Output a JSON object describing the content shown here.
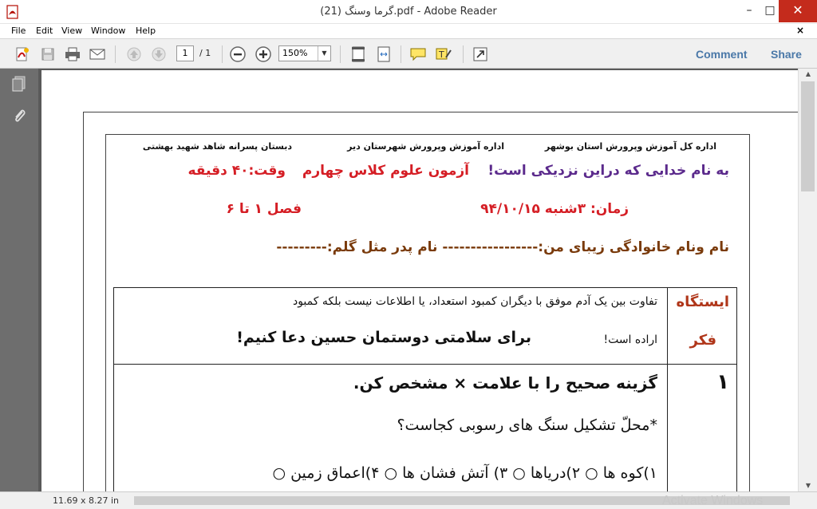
{
  "window": {
    "title": "گرما وسنگ (21).pdf - Adobe Reader",
    "minimize": "–",
    "maximize": "□",
    "close": "✕"
  },
  "menu": {
    "items": [
      "File",
      "Edit",
      "View",
      "Window",
      "Help"
    ],
    "close": "×"
  },
  "toolbar": {
    "page_current": "1",
    "page_total": "/ 1",
    "zoom": "150%",
    "comment_label": "Comment",
    "share_label": "Share"
  },
  "status": {
    "page_size": "11.69 x 8.27 in",
    "watermark": "Activate Windows"
  },
  "document": {
    "header_row1": {
      "right": "اداره کل آموزش وپرورش استان بوشهر",
      "middle": "اداره آموزش وپرورش شهرستان دیر",
      "left": "دبستان پسرانه شاهد شهید بهشتی"
    },
    "header_row2": {
      "right": "به نام خدایی که دراین نزدیکی است!",
      "middle": "آزمون علوم کلاس چهارم",
      "left": "وقت:۴۰ دقیقه"
    },
    "header_row3": {
      "right": "زمان: ۳شنبه ۹۴/۱۰/۱۵",
      "left": "فصل ۱ تا ۶"
    },
    "header_row4": "نام ونام خانوادگی زیبای من:----------------- نام پدر مثل گلم:---------",
    "station": {
      "line1": "ایستگاه",
      "line2": "فکر",
      "text_line1": "تفاوت بین یک آدم موفق با دیگران کمبود استعداد، یا اطلاعات نیست بلکه کمبود",
      "text_line2": "اراده است!",
      "prayer": "برای سلامتی دوستمان حسین دعا کنیم!"
    },
    "question1": {
      "number": "۱",
      "title": "گزینه صحیح را با علامت × مشخص کن.",
      "prompt": "*محلّ تشکیل سنگ های رسوبی کجاست؟",
      "options": "۱)کوه ها ○ ۲)دریاها ○ ۳) آتش فشان ها ○ ۴)اعماق زمین ○"
    }
  }
}
